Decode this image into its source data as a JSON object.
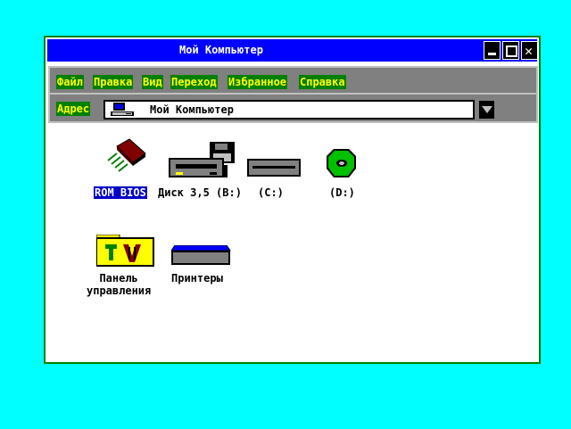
{
  "window": {
    "title": "Мой Компьютер",
    "close_glyph": "✕"
  },
  "menu": {
    "file": "Файл",
    "edit": "Правка",
    "view": "Вид",
    "go": "Переход",
    "favorites": "Избранное",
    "help": "Справка"
  },
  "address": {
    "label": "Адрес",
    "value": "Мой Компьютер",
    "icon": "computer-icon"
  },
  "items": {
    "rom": {
      "label": "ROM BIOS",
      "icon": "chip-icon",
      "selected": true
    },
    "floppy": {
      "label": "Диск 3,5 (B:)",
      "icon": "floppy-drive-icon"
    },
    "c": {
      "label": "(C:)",
      "icon": "hard-drive-icon"
    },
    "d": {
      "label": "(D:)",
      "icon": "cd-drive-icon"
    },
    "panel": {
      "label_line1": "Панель",
      "label_line2": "управления",
      "icon": "control-panel-icon"
    },
    "printers": {
      "label": "Принтеры",
      "icon": "printer-icon"
    }
  },
  "colors": {
    "desktop": "#00ffff",
    "titlebar": "#0000ff",
    "menu_bg": "#008000",
    "menu_text": "#ffff00",
    "selection": "#0000c8"
  }
}
